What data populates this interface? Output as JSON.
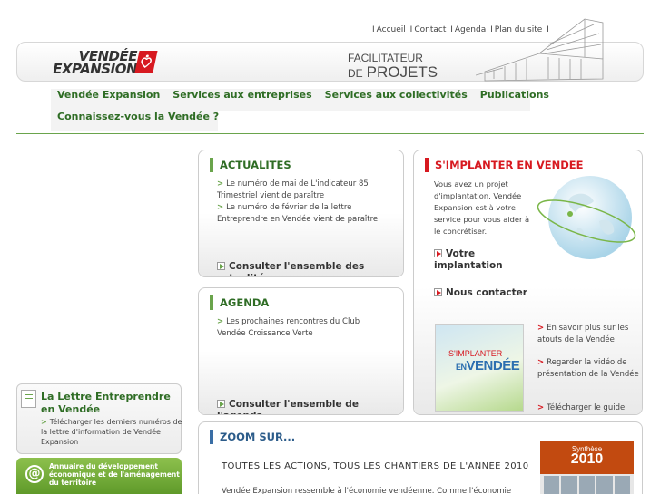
{
  "toplinks": [
    "Accueil",
    "Contact",
    "Agenda",
    "Plan du site"
  ],
  "header": {
    "logo_line1": "VENDÉE",
    "logo_line2": "EXPANSION",
    "tag_small": "FACILITATEUR",
    "tag_de": "DE",
    "tag_big": "PROJETS"
  },
  "nav": {
    "items": [
      "Vendée Expansion",
      "Services aux entreprises",
      "Services aux collectivités",
      "Publications"
    ],
    "item2": "Connaissez-vous la Vendée ?"
  },
  "left": {
    "lettre_title": "La Lettre Entreprendre en Vendée",
    "lettre_text": "Télécharger les derniers numéros de la lettre d'information de Vendée Expansion",
    "annuaire_text": "Annuaire du développement économique et de l'aménagement du territoire"
  },
  "actualites": {
    "title": "ACTUALITES",
    "items": [
      "Le numéro de mai de L'indicateur 85 Trimestriel vient de paraître",
      "Le numéro de février de la lettre Entreprendre en Vendée vient de paraître"
    ],
    "more": "Consulter l'ensemble des actualités"
  },
  "agenda": {
    "title": "AGENDA",
    "items": [
      "Les prochaines rencontres du Club Vendée Croissance Verte"
    ],
    "more": "Consulter l'ensemble de l'agenda"
  },
  "implanter": {
    "title": "S'IMPLANTER EN VENDEE",
    "intro": "Vous avez un projet d'implantation. Vendée Expansion est à votre service pour vous aider à le concrétiser.",
    "link1": "Votre implantation",
    "link2": "Nous contacter",
    "cover_line1": "S'IMPLANTER",
    "cover_line2_small": "EN",
    "cover_line2": "VENDÉE",
    "links": [
      "En savoir plus sur les atouts de la Vendée",
      "Regarder la vidéo de présentation de la Vendée",
      "Télécharger le guide"
    ]
  },
  "zoom": {
    "title": "ZOOM SUR...",
    "headline": "TOUTES LES ACTIONS, TOUS LES CHANTIERS DE L'ANNEE 2010",
    "text": "Vendée Expansion ressemble à l'économie vendéenne. Comme l'économie",
    "synth_label": "Synthèse",
    "synth_year": "2010"
  },
  "colors": {
    "green": "#2f6d25",
    "accent_green": "#6aa44c",
    "red": "#d71920",
    "blue": "#2c5c8a"
  }
}
